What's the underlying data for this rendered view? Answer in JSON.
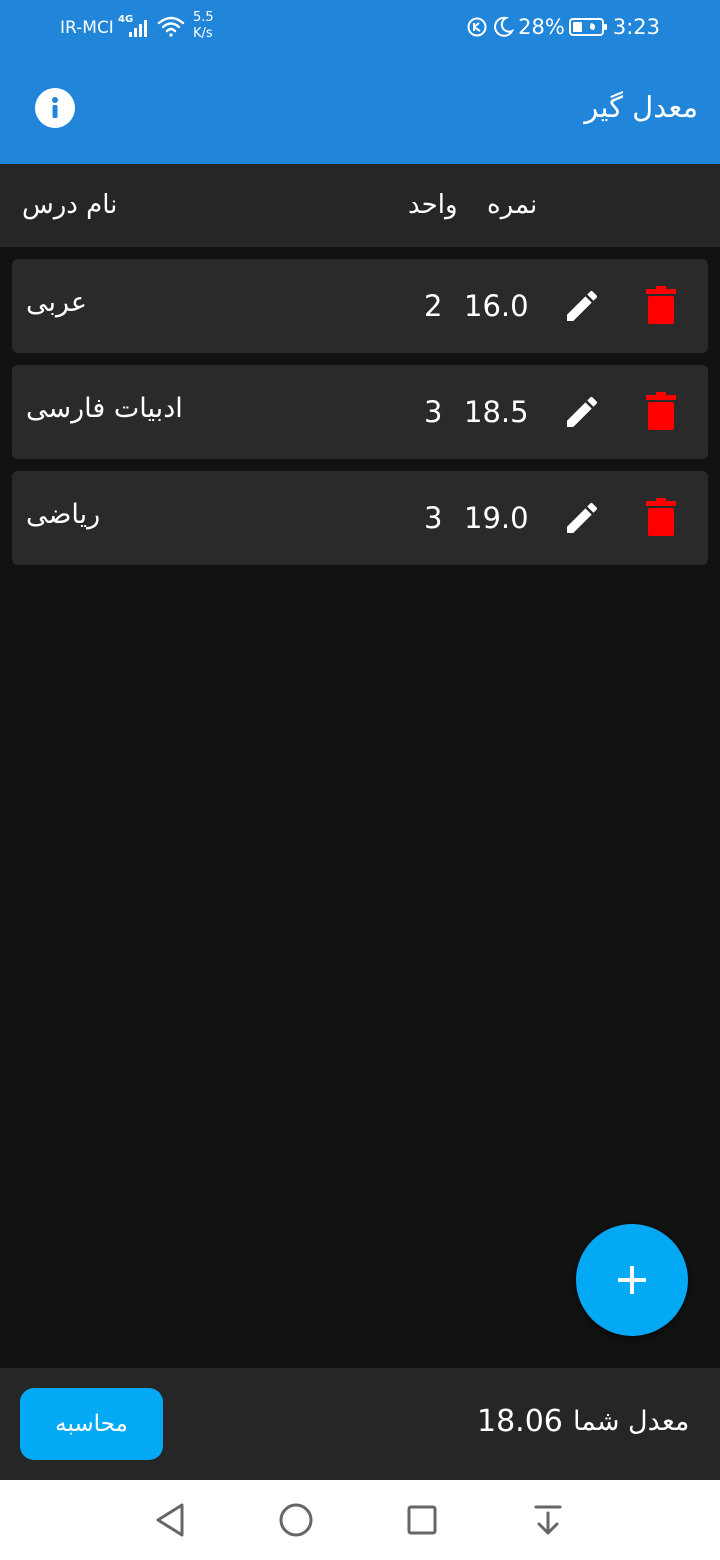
{
  "status_bar": {
    "carrier": "IR-MCI",
    "network": "4G",
    "speed_value": "5.5",
    "speed_unit": "K/s",
    "battery": "28%",
    "time": "3:23"
  },
  "app_bar": {
    "title": "معدل گیر",
    "info_icon": "info-icon"
  },
  "table_header": {
    "name": "نام درس",
    "unit": "واحد",
    "grade": "نمره"
  },
  "courses": [
    {
      "name": "عربی",
      "unit": "2",
      "grade": "16.0"
    },
    {
      "name": "ادبیات فارسی",
      "unit": "3",
      "grade": "18.5"
    },
    {
      "name": "ریاضی",
      "unit": "3",
      "grade": "19.0"
    }
  ],
  "footer": {
    "average_label": "معدل شما",
    "average_value": "18.06",
    "calculate_label": "محاسبه"
  },
  "colors": {
    "app_bar": "#2186d9",
    "accent": "#03a9f4",
    "delete": "#ff0000",
    "background": "#121212",
    "card": "#2a2a2a"
  },
  "icons": {
    "edit": "pencil-icon",
    "delete": "trash-icon",
    "add": "plus-icon"
  }
}
